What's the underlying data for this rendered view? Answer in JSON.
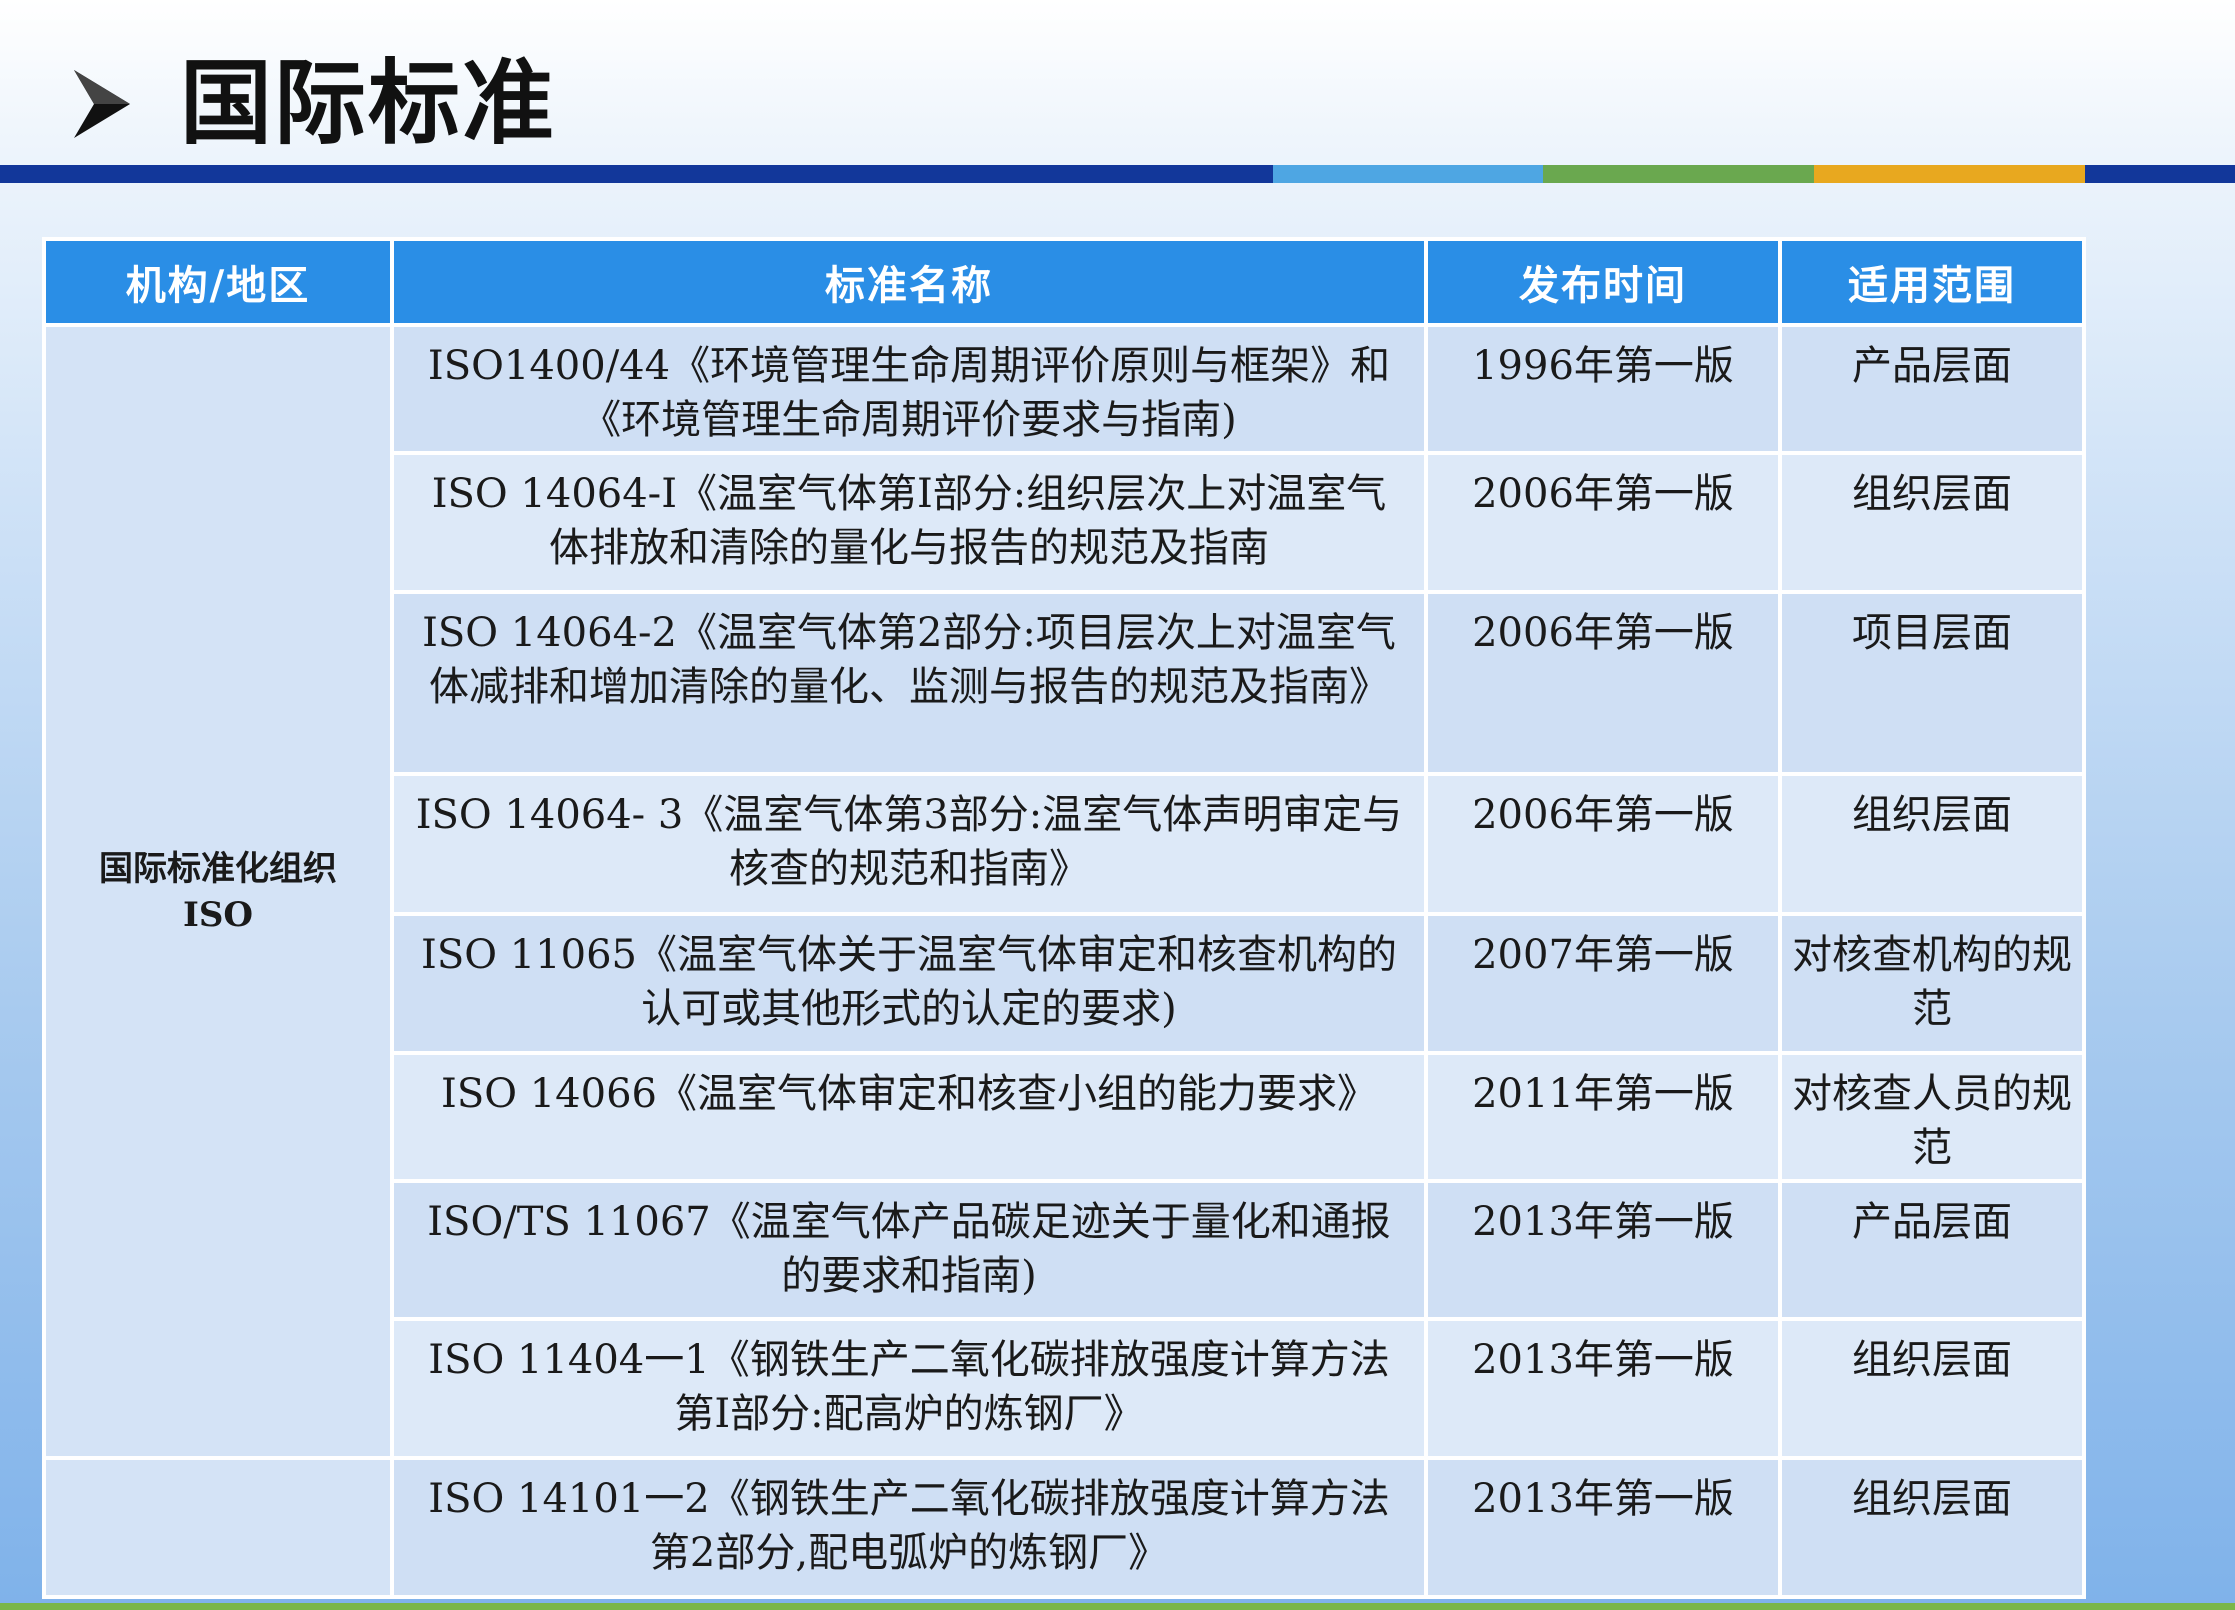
{
  "slide": {
    "title": "国际标准",
    "bullet_icon": "arrow-bullet-icon",
    "stripe_colors": [
      "#12379a",
      "#4ea6e3",
      "#6aa84f",
      "#e8a81f",
      "#12379a"
    ]
  },
  "table": {
    "headers": {
      "org": "机构/地区",
      "name": "标准名称",
      "date": "发布时间",
      "scope": "适用范围"
    },
    "org_line1": "国际标准化组织",
    "org_line2": "ISO",
    "rows": [
      {
        "name": "ISO1400/44《环境管理生命周期评价原则与框架》和《环境管理生命周期评价要求与指南)",
        "date": "1996年第一版",
        "scope": "产品层面"
      },
      {
        "name": "ISO 14064-I《温室气体第I部分:组织层次上对温室气体排放和清除的量化与报告的规范及指南",
        "date": "2006年第一版",
        "scope": "组织层面"
      },
      {
        "name": "ISO 14064-2《温室气体第2部分:项目层次上对温室气体减排和增加清除的量化、监测与报告的规范及指南》",
        "date": "2006年第一版",
        "scope": "项目层面"
      },
      {
        "name": "ISO 14064- 3《温室气体第3部分:温室气体声明审定与核查的规范和指南》",
        "date": "2006年第一版",
        "scope": "组织层面"
      },
      {
        "name": "ISO 11065《温室气体关于温室气体审定和核查机构的认可或其他形式的认定的要求)",
        "date": "2007年第一版",
        "scope": "对核查机构的规范"
      },
      {
        "name": "ISO 14066《温室气体审定和核查小组的能力要求》",
        "date": "2011年第一版",
        "scope": "对核查人员的规范"
      },
      {
        "name": "ISO/TS 11067《温室气体产品碳足迹关于量化和通报的要求和指南)",
        "date": "2013年第一版",
        "scope": "产品层面"
      },
      {
        "name": "ISO 11404一1《钢铁生产二氧化碳排放强度计算方法第I部分:配高炉的炼钢厂》",
        "date": "2013年第一版",
        "scope": "组织层面"
      },
      {
        "name": "ISO 14101一2《钢铁生产二氧化碳排放强度计算方法第2部分,配电弧炉的炼钢厂》",
        "date": "2013年第一版",
        "scope": "组织层面"
      }
    ]
  }
}
